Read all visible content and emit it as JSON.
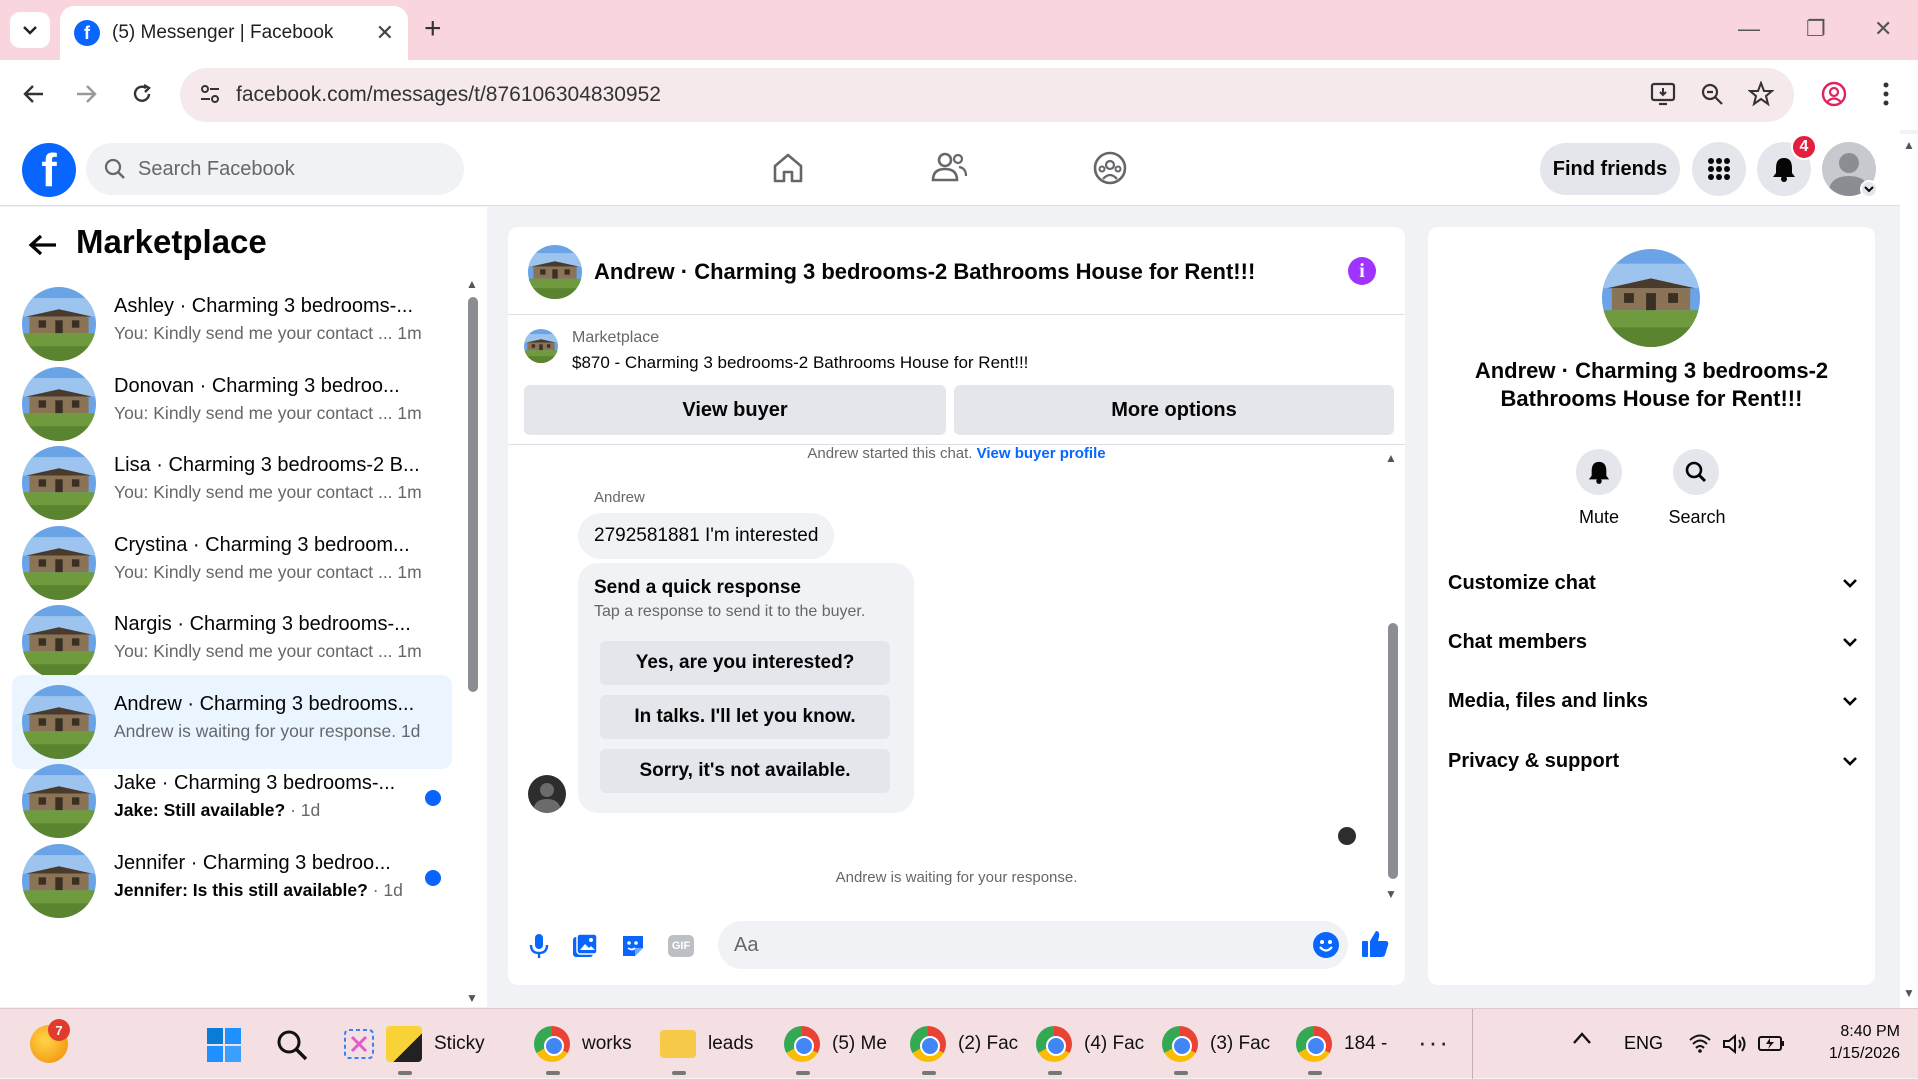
{
  "browser": {
    "tab_title": "(5) Messenger | Facebook",
    "url": "facebook.com/messages/t/876106304830952"
  },
  "fb_header": {
    "search_placeholder": "Search Facebook",
    "find_friends": "Find friends",
    "notification_count": "4"
  },
  "sidebar": {
    "title": "Marketplace",
    "conversations": [
      {
        "name": "Ashley · Charming 3 bedrooms-...",
        "preview": "You: Kindly send me your contact ...",
        "time": "1m",
        "unread": false,
        "active": false
      },
      {
        "name": "Donovan · Charming 3 bedroo...",
        "preview": "You: Kindly send me your contact ...",
        "time": "1m",
        "unread": false,
        "active": false
      },
      {
        "name": "Lisa · Charming 3 bedrooms-2 B...",
        "preview": "You: Kindly send me your contact ...",
        "time": "1m",
        "unread": false,
        "active": false
      },
      {
        "name": "Crystina · Charming 3 bedroom...",
        "preview": "You: Kindly send me your contact ...",
        "time": "1m",
        "unread": false,
        "active": false
      },
      {
        "name": "Nargis · Charming 3 bedrooms-...",
        "preview": "You: Kindly send me your contact ...",
        "time": "1m",
        "unread": false,
        "active": false
      },
      {
        "name": "Andrew · Charming 3 bedrooms...",
        "preview": "Andrew is waiting for your response.",
        "time": "1d",
        "unread": false,
        "active": true
      },
      {
        "name": "Jake · Charming 3 bedrooms-...",
        "preview": "Jake: Still available?",
        "time": "1d",
        "unread": true,
        "active": false
      },
      {
        "name": "Jennifer · Charming 3 bedroo...",
        "preview": "Jennifer: Is this still available?",
        "time": "1d",
        "unread": true,
        "active": false
      }
    ]
  },
  "chat": {
    "title": "Andrew · Charming 3 bedrooms-2 Bathrooms House for Rent!!!",
    "listing_label": "Marketplace",
    "listing_text": "$870 - Charming 3 bedrooms-2 Bathrooms House for Rent!!!",
    "view_buyer": "View buyer",
    "more_options": "More options",
    "started_text": "Andrew started this chat.",
    "view_profile_link": "View buyer profile",
    "sender": "Andrew",
    "message": "2792581881 I'm interested",
    "quick_title": "Send a quick response",
    "quick_subtitle": "Tap a response to send it to the buyer.",
    "quick_replies": [
      "Yes, are you interested?",
      "In talks. I'll let you know.",
      "Sorry, it's not available."
    ],
    "waiting": "Andrew is waiting for your response.",
    "composer_placeholder": "Aa"
  },
  "info": {
    "title": "Andrew · Charming 3 bedrooms-2 Bathrooms House for Rent!!!",
    "mute": "Mute",
    "search": "Search",
    "sections": [
      "Customize chat",
      "Chat members",
      "Media, files and links",
      "Privacy & support"
    ]
  },
  "taskbar": {
    "items": [
      {
        "label": "Sticky"
      },
      {
        "label": "works"
      },
      {
        "label": "leads"
      },
      {
        "label": "(5) Me"
      },
      {
        "label": "(2) Fac"
      },
      {
        "label": "(4) Fac"
      },
      {
        "label": "(3) Fac"
      },
      {
        "label": "184 -"
      }
    ],
    "start_badge": "7",
    "language": "ENG",
    "time": "8:40 PM",
    "date": "1/15/2026"
  },
  "colors": {
    "brand": "#0866ff",
    "accent_purple": "#a033ff",
    "badge_red": "#e41e3f"
  }
}
